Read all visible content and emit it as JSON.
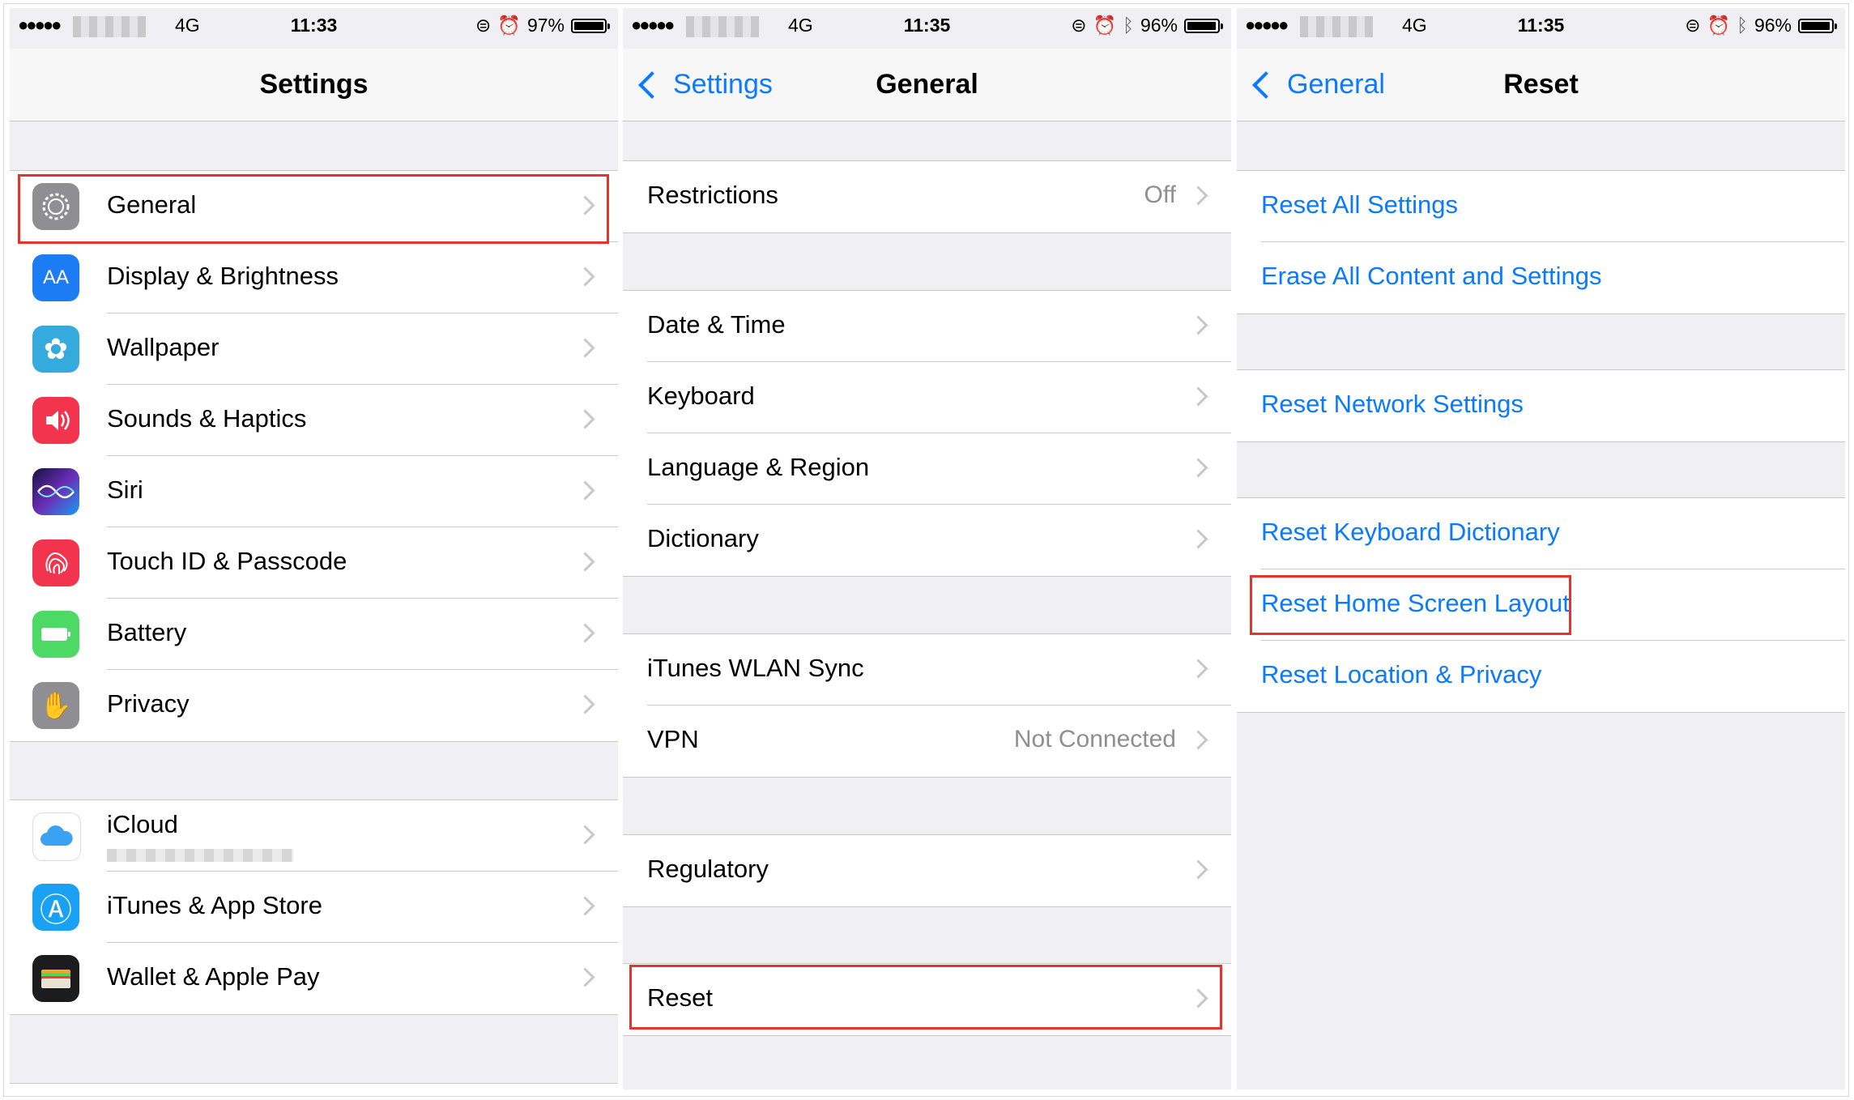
{
  "phone1": {
    "status": {
      "signal_dots": "●●●●●",
      "network": "4G",
      "time": "11:33",
      "battery": "97%",
      "battery_level": 0.97
    },
    "nav": {
      "title": "Settings"
    },
    "group1": [
      {
        "label": "General",
        "icon": "gear-icon",
        "color": "#8e8e93"
      },
      {
        "label": "Display & Brightness",
        "icon": "display-icon",
        "color": "#1b7cf4",
        "glyph": "AA"
      },
      {
        "label": "Wallpaper",
        "icon": "wallpaper-flower-icon",
        "color": "#35aadc",
        "glyph": "✿"
      },
      {
        "label": "Sounds & Haptics",
        "icon": "speaker-icon",
        "color": "#f2344f",
        "glyph": "🔊"
      },
      {
        "label": "Siri",
        "icon": "siri-icon",
        "color": "#1c1c3c"
      },
      {
        "label": "Touch ID & Passcode",
        "icon": "fingerprint-icon",
        "color": "#f2344f"
      },
      {
        "label": "Battery",
        "icon": "battery-icon",
        "color": "#4cd964"
      },
      {
        "label": "Privacy",
        "icon": "hand-icon",
        "color": "#8e8e93",
        "glyph": "✋"
      }
    ],
    "group2": [
      {
        "label": "iCloud",
        "icon": "icloud-icon",
        "color": "#ffffff"
      },
      {
        "label": "iTunes & App Store",
        "icon": "app-store-icon",
        "color": "#1aa1f3",
        "glyph": "Ⓐ"
      },
      {
        "label": "Wallet & Apple Pay",
        "icon": "wallet-icon",
        "color": "#1c1c1e"
      }
    ]
  },
  "phone2": {
    "status": {
      "signal_dots": "●●●●●",
      "network": "4G",
      "time": "11:35",
      "battery": "96%",
      "battery_level": 0.96
    },
    "nav": {
      "back": "Settings",
      "title": "General"
    },
    "restrictions": {
      "label": "Restrictions",
      "value": "Off"
    },
    "group_time": [
      "Date & Time",
      "Keyboard",
      "Language & Region",
      "Dictionary"
    ],
    "itunes_sync": {
      "label": "iTunes WLAN Sync"
    },
    "vpn": {
      "label": "VPN",
      "value": "Not Connected"
    },
    "regulatory": {
      "label": "Regulatory"
    },
    "reset": {
      "label": "Reset"
    }
  },
  "phone3": {
    "status": {
      "signal_dots": "●●●●●",
      "network": "4G",
      "time": "11:35",
      "battery": "96%",
      "battery_level": 0.96
    },
    "nav": {
      "back": "General",
      "title": "Reset"
    },
    "group1": [
      "Reset All Settings",
      "Erase All Content and Settings"
    ],
    "group2": [
      "Reset Network Settings"
    ],
    "group3": [
      "Reset Keyboard Dictionary",
      "Reset Home Screen Layout",
      "Reset Location & Privacy"
    ]
  }
}
